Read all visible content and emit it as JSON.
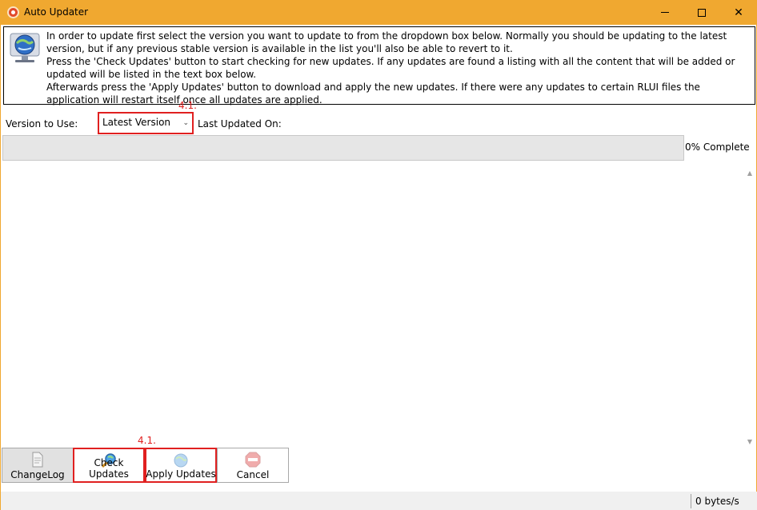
{
  "window": {
    "title": "Auto Updater"
  },
  "info": {
    "paragraphs": [
      "In order to update first select the version you want to update to from the dropdown box below. Normally you should be updating to the latest version, but if any previous stable version is available in the list you'll also be able to revert to it.",
      "Press the 'Check Updates' button to start checking for new updates. If any updates are found a listing with all the content that will be added or updated will be listed in the text box below.",
      "Afterwards press the 'Apply Updates' button to download and apply the new updates. If there were any updates to certain RLUI files the application will restart itself once all updates are applied."
    ]
  },
  "version": {
    "label": "Version to Use:",
    "selected": "Latest Version",
    "last_updated_label": "Last Updated On:"
  },
  "annotations": {
    "top": "4.1.",
    "bottom": "4.1."
  },
  "progress": {
    "percent": 0,
    "text": "0% Complete"
  },
  "toolbar": {
    "changelog_label": "ChangeLog",
    "check_label": "Check Updates",
    "apply_label": "Apply Updates",
    "cancel_label": "Cancel"
  },
  "status": {
    "speed": "0 bytes/s"
  },
  "colors": {
    "titlebar": "#f0a830",
    "annotation": "#e02020"
  },
  "icons": {
    "app": "app-icon",
    "info": "globe-monitor-icon",
    "changelog": "document-icon",
    "check": "magnifier-icon",
    "apply": "globe-icon",
    "cancel": "stop-sign-icon"
  }
}
